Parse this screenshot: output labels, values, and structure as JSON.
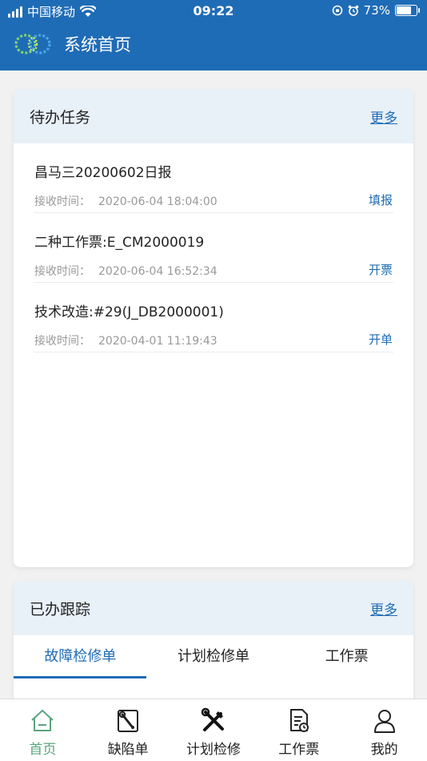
{
  "status_bar": {
    "carrier": "中国移动",
    "time": "09:22",
    "battery": "73%",
    "battery_level": 0.73
  },
  "header": {
    "title": "系统首页"
  },
  "todo": {
    "title": "待办任务",
    "more": "更多",
    "items": [
      {
        "name": "昌马三20200602日报",
        "time_label": "接收时间：",
        "time": "2020-06-04 18:04:00",
        "action": "填报"
      },
      {
        "name": "二种工作票:E_CM2000019",
        "time_label": "接收时间：",
        "time": "2020-06-04 16:52:34",
        "action": "开票"
      },
      {
        "name": "技术改造:#29(J_DB2000001)",
        "time_label": "接收时间：",
        "time": "2020-04-01 11:19:43",
        "action": "开单"
      }
    ]
  },
  "done": {
    "title": "已办跟踪",
    "more": "更多",
    "tabs": [
      {
        "label": "故障检修单",
        "active": true
      },
      {
        "label": "计划检修单",
        "active": false
      },
      {
        "label": "工作票",
        "active": false
      }
    ]
  },
  "bottom_nav": {
    "items": [
      {
        "label": "首页",
        "icon": "home-icon",
        "active": true
      },
      {
        "label": "缺陷单",
        "icon": "defect-wrench-icon",
        "active": false
      },
      {
        "label": "计划检修",
        "icon": "tools-icon",
        "active": false
      },
      {
        "label": "工作票",
        "icon": "ticket-icon",
        "active": false
      },
      {
        "label": "我的",
        "icon": "user-icon",
        "active": false
      }
    ]
  },
  "colors": {
    "header_blue": "#1f6cb6",
    "accent_blue": "#1f6cb6",
    "nav_active_green": "#5aa57e"
  }
}
